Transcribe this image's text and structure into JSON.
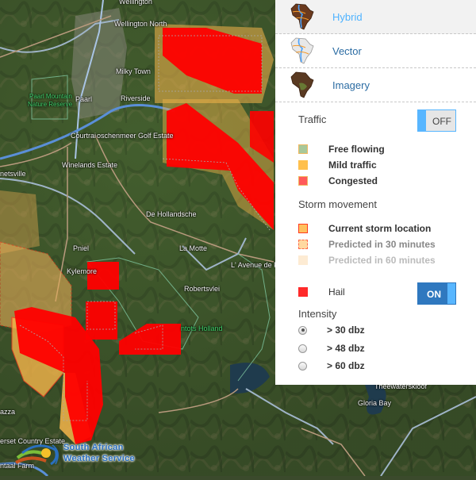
{
  "map": {
    "labels": [
      {
        "id": "wellington",
        "text": "Wellington",
        "green": false
      },
      {
        "id": "wellington-north",
        "text": "Wellington North",
        "green": false
      },
      {
        "id": "milky-town",
        "text": "Milky Town",
        "green": false
      },
      {
        "id": "paarl-reserve-1",
        "text": "Paarl Mountain",
        "green": true
      },
      {
        "id": "paarl-reserve-2",
        "text": "Nature Reserve",
        "green": true
      },
      {
        "id": "paarl",
        "text": "Paarl",
        "green": false
      },
      {
        "id": "riverside",
        "text": "Riverside",
        "green": false
      },
      {
        "id": "courtrai",
        "text": "Courtrai",
        "green": false
      },
      {
        "id": "boschenmeer",
        "text": "oschenmeer Golf Estate",
        "green": false
      },
      {
        "id": "winelands",
        "text": "Winelands Estate",
        "green": false
      },
      {
        "id": "ruetsville",
        "text": "netsville",
        "green": false
      },
      {
        "id": "de-hollandsche",
        "text": "De Hollandsche",
        "green": false
      },
      {
        "id": "pniel",
        "text": "Pniel",
        "green": false
      },
      {
        "id": "kylemore",
        "text": "Kylemore",
        "green": false
      },
      {
        "id": "la-motte",
        "text": "La Motte",
        "green": false
      },
      {
        "id": "avenue",
        "text": "L' Avenue de Fr",
        "green": false
      },
      {
        "id": "robertsvlei",
        "text": "Robertsvlei",
        "green": false
      },
      {
        "id": "hottentots",
        "text": "ntots Holland",
        "green": true
      },
      {
        "id": "theewaterskloof",
        "text": "Theewaterskloof",
        "green": false
      },
      {
        "id": "gloria-bay",
        "text": "Gloria Bay",
        "green": false
      },
      {
        "id": "azza",
        "text": "azza",
        "green": false
      },
      {
        "id": "somerset",
        "text": "erset Country Estate",
        "green": false
      },
      {
        "id": "ntaal",
        "text": "ntaal Farm",
        "green": false
      }
    ],
    "colors": {
      "current_storm_fill": "#ff0000",
      "predicted_fill": "#f5b54a",
      "storm_border": "#ff3b1f"
    }
  },
  "layers": [
    {
      "label": "Hybrid",
      "icon": "africa-hybrid-icon",
      "active": true
    },
    {
      "label": "Vector",
      "icon": "africa-vector-icon",
      "active": false
    },
    {
      "label": "Imagery",
      "icon": "africa-imagery-icon",
      "active": false
    }
  ],
  "traffic": {
    "title": "Traffic",
    "toggle_label": "OFF",
    "legend": [
      {
        "label": "Free flowing",
        "color": "#a8c89a"
      },
      {
        "label": "Mild traffic",
        "color": "#ffc04d"
      },
      {
        "label": "Congested",
        "color": "#ff5a5a"
      }
    ]
  },
  "storm": {
    "title": "Storm movement",
    "legend": [
      {
        "label": "Current storm location"
      },
      {
        "label": "Predicted in 30 minutes"
      },
      {
        "label": "Predicted in 60 minutes"
      }
    ]
  },
  "hail": {
    "label": "Hail",
    "toggle_label": "ON",
    "color": "#ff2a2a"
  },
  "intensity": {
    "title": "Intensity",
    "options": [
      {
        "label": "> 30 dbz",
        "checked": true
      },
      {
        "label": "> 48 dbz",
        "checked": false
      },
      {
        "label": "> 60 dbz",
        "checked": false
      }
    ]
  },
  "logo": {
    "line1": "South African",
    "line2": "Weather Service"
  }
}
